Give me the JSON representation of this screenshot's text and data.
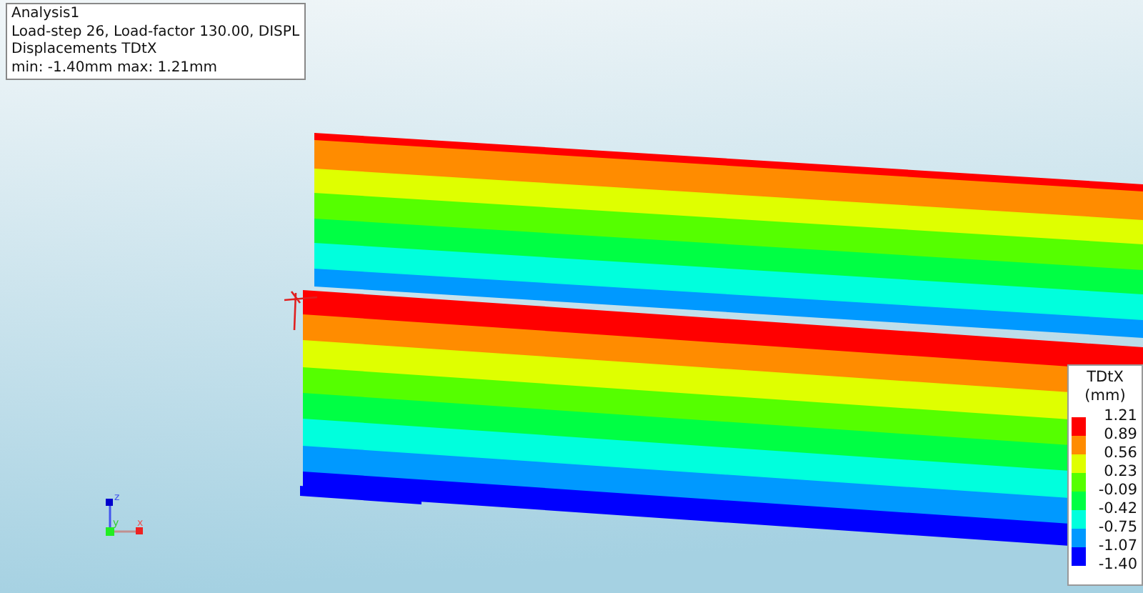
{
  "info": {
    "lines": [
      "Analysis1",
      "Load-step 26, Load-factor 130.00, DISPL",
      "Displacements TDtX",
      "min: -1.40mm max:  1.21mm"
    ]
  },
  "legend": {
    "title": "TDtX",
    "unit": "(mm)",
    "labels": [
      "1.21",
      "0.89",
      "0.56",
      "0.23",
      "-0.09",
      "-0.42",
      "-0.75",
      "-1.07",
      "-1.40"
    ],
    "swatches": [
      {
        "color": "#ff0000"
      },
      {
        "color": "#ff8c00"
      },
      {
        "color": "#dfff00"
      },
      {
        "color": "#55ff00"
      },
      {
        "color": "#00ff44"
      },
      {
        "color": "#00ffdd"
      },
      {
        "color": "#0099ff"
      },
      {
        "color": "#0000ff"
      }
    ]
  },
  "axes": {
    "x": "x",
    "y": "y",
    "z": "z"
  }
}
